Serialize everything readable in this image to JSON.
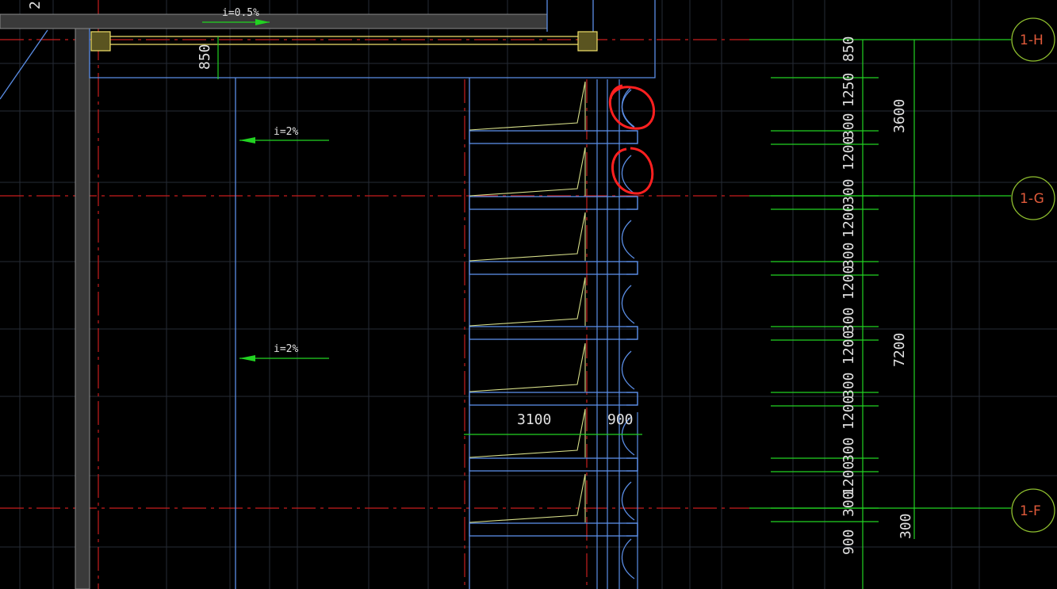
{
  "window": {
    "title": ""
  },
  "grid_labels": [
    "1-H",
    "1-G",
    "1-F"
  ],
  "slopes": {
    "top": "i=0.5%",
    "mid": "i=2%",
    "low": "i=2%"
  },
  "dims_left": {
    "top_850": "850",
    "cut_2": "2"
  },
  "dims_bottom": {
    "d3100": "3100",
    "d900": "900"
  },
  "dims_right_col": [
    "850",
    "1250",
    "300",
    "1200",
    "300",
    "1200",
    "300",
    "1200",
    "300",
    "1200",
    "300",
    "1200",
    "300",
    "1200",
    "300",
    "900",
    "300",
    "1200"
  ],
  "dims_overall": {
    "d3600": "3600",
    "d7200": "7200",
    "d300": "300"
  },
  "annotation_color": "#ff2020",
  "colors": {
    "grid_red": "#c81e1e",
    "dim_green": "#22d322",
    "outline_blue": "#5b8ee6",
    "yellow": "#f0e06a"
  }
}
